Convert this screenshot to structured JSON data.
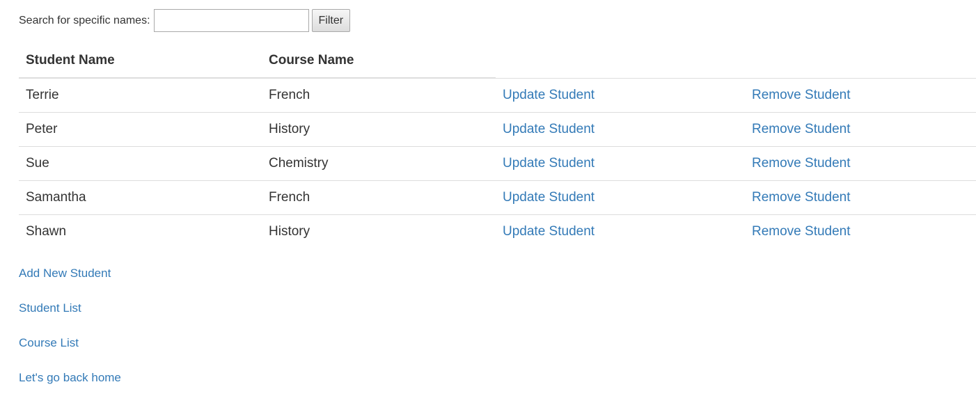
{
  "filter": {
    "label": "Search for specific names:",
    "input_value": "",
    "input_placeholder": "",
    "button_label": "Filter"
  },
  "table": {
    "headers": [
      "Student Name",
      "Course Name",
      "",
      ""
    ],
    "rows": [
      {
        "student": "Terrie",
        "course": "French",
        "update": "Update Student",
        "remove": "Remove Student"
      },
      {
        "student": "Peter",
        "course": "History",
        "update": "Update Student",
        "remove": "Remove Student"
      },
      {
        "student": "Sue",
        "course": "Chemistry",
        "update": "Update Student",
        "remove": "Remove Student"
      },
      {
        "student": "Samantha",
        "course": "French",
        "update": "Update Student",
        "remove": "Remove Student"
      },
      {
        "student": "Shawn",
        "course": "History",
        "update": "Update Student",
        "remove": "Remove Student"
      }
    ]
  },
  "nav": {
    "links": [
      "Add New Student",
      "Student List",
      "Course List",
      "Let's go back home"
    ]
  },
  "colors": {
    "link": "#337ab7",
    "text": "#333333",
    "border": "#dddddd"
  }
}
